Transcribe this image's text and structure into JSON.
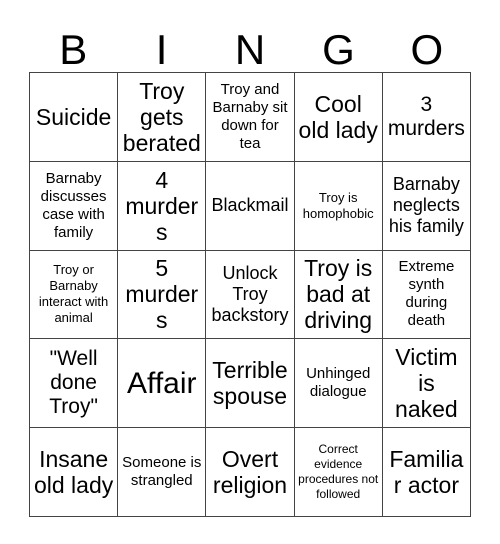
{
  "card": {
    "header_letters": [
      "B",
      "I",
      "N",
      "G",
      "O"
    ],
    "rows": [
      [
        {
          "text": "Suicide",
          "size": "xl"
        },
        {
          "text": "Troy gets berated",
          "size": "xl"
        },
        {
          "text": "Troy and Barnaby sit down for tea",
          "size": "sm"
        },
        {
          "text": "Cool old lady",
          "size": "xl"
        },
        {
          "text": "3 murders",
          "size": "lg"
        }
      ],
      [
        {
          "text": "Barnaby discusses case with family",
          "size": "sm"
        },
        {
          "text": "4 murders",
          "size": "xl"
        },
        {
          "text": "Blackmail",
          "size": "md"
        },
        {
          "text": "Troy is homophobic",
          "size": "xs"
        },
        {
          "text": "Barnaby neglects his family",
          "size": "md"
        }
      ],
      [
        {
          "text": "Troy or Barnaby interact with animal",
          "size": "xs"
        },
        {
          "text": "5 murders",
          "size": "xl"
        },
        {
          "text": "Unlock Troy backstory",
          "size": "md"
        },
        {
          "text": "Troy is bad at driving",
          "size": "xl"
        },
        {
          "text": "Extreme synth during death",
          "size": "sm"
        }
      ],
      [
        {
          "text": "\"Well done Troy\"",
          "size": "lg"
        },
        {
          "text": "Affair",
          "size": "xxl"
        },
        {
          "text": "Terrible spouse",
          "size": "xl"
        },
        {
          "text": "Unhinged dialogue",
          "size": "sm"
        },
        {
          "text": "Victim is naked",
          "size": "xl"
        }
      ],
      [
        {
          "text": "Insane old lady",
          "size": "xl"
        },
        {
          "text": "Someone is strangled",
          "size": "sm"
        },
        {
          "text": "Overt religion",
          "size": "xl"
        },
        {
          "text": "Correct evidence procedures not followed",
          "size": "xxs"
        },
        {
          "text": "Familiar actor",
          "size": "xl"
        }
      ]
    ]
  },
  "colors": {
    "background": "#ffffff",
    "text": "#000000",
    "grid_line": "#444444"
  }
}
